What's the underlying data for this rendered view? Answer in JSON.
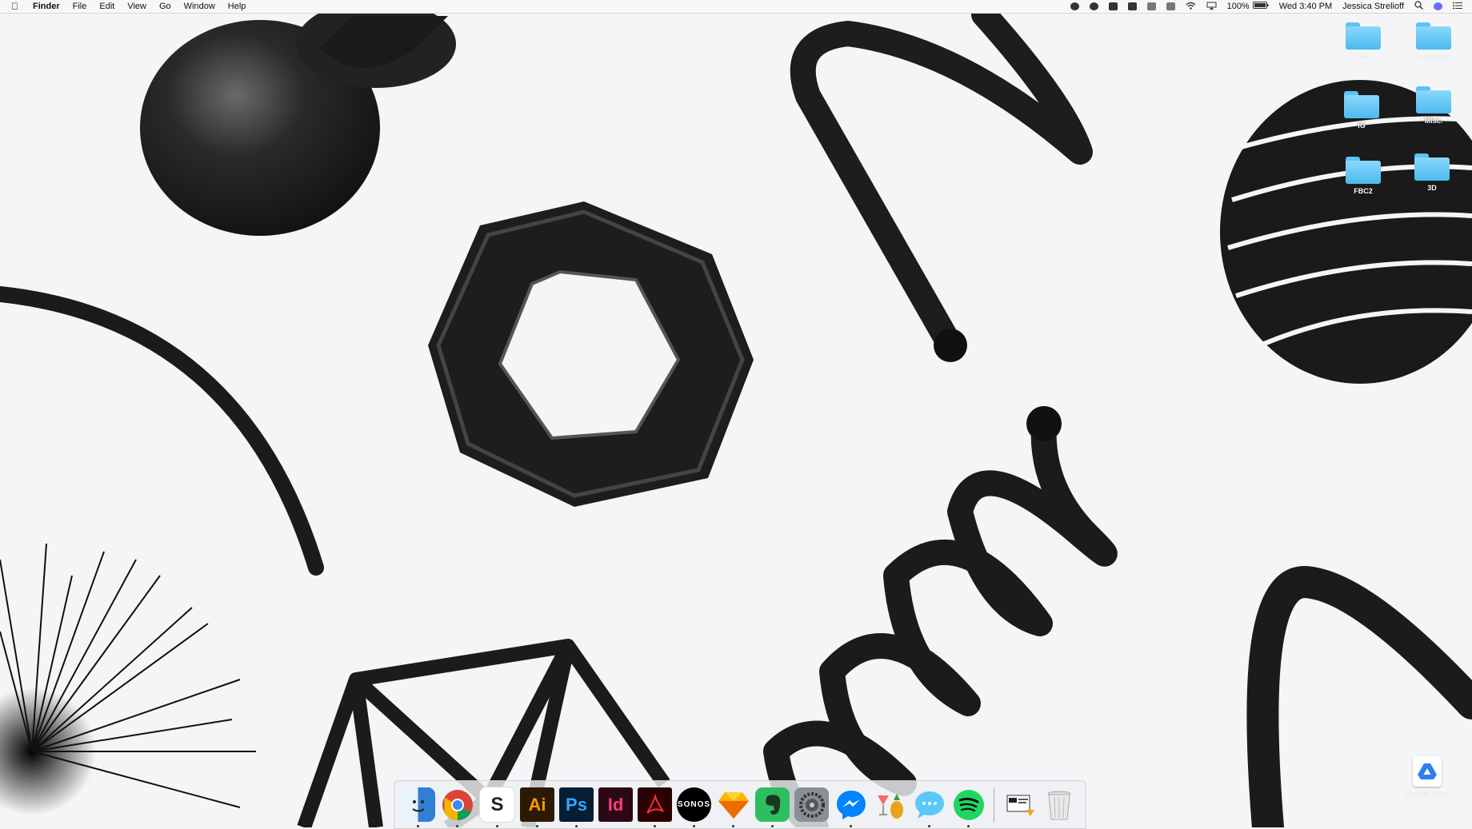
{
  "menubar": {
    "apple_icon": "apple-logo-icon",
    "app_name": "Finder",
    "menus": [
      "File",
      "Edit",
      "View",
      "Go",
      "Window",
      "Help"
    ],
    "status_icons": [
      "skype-icon",
      "creative-cloud-icon",
      "flux-icon",
      "dropbox-icon",
      "google-drive-icon",
      "bluetooth-icon",
      "wifi-icon",
      "airplay-icon"
    ],
    "battery": "100%",
    "datetime": "Wed 3:40 PM",
    "user": "Jessica Strelioff",
    "right_icons": [
      "spotlight-icon",
      "siri-icon",
      "notification-center-icon"
    ]
  },
  "desktop_icons": [
    {
      "label": "RH",
      "kind": "folder",
      "faint": true
    },
    {
      "label": "inspiration",
      "kind": "folder",
      "faint": true
    },
    {
      "label": "IG",
      "kind": "folder",
      "faint": false
    },
    {
      "label": "Misc.",
      "kind": "folder",
      "faint": false
    },
    {
      "label": "FBC2",
      "kind": "folder",
      "faint": false
    },
    {
      "label": "3D",
      "kind": "folder",
      "faint": false
    },
    {
      "label": "Google Drive",
      "kind": "app",
      "faint": true
    }
  ],
  "dock": {
    "apps": [
      {
        "name": "Finder",
        "icon": "finder-icon",
        "running": true
      },
      {
        "name": "Google Chrome",
        "icon": "chrome-icon",
        "running": true
      },
      {
        "name": "Slack",
        "icon": "slack-icon",
        "running": true,
        "glyph": "S"
      },
      {
        "name": "Adobe Illustrator",
        "icon": "illustrator-icon",
        "running": true,
        "glyph": "Ai"
      },
      {
        "name": "Adobe Photoshop",
        "icon": "photoshop-icon",
        "running": true,
        "glyph": "Ps"
      },
      {
        "name": "Adobe InDesign",
        "icon": "indesign-icon",
        "running": false,
        "glyph": "Id"
      },
      {
        "name": "Adobe Acrobat",
        "icon": "acrobat-icon",
        "running": true
      },
      {
        "name": "Sonos",
        "icon": "sonos-icon",
        "running": true,
        "glyph": "SONOS"
      },
      {
        "name": "Sketch",
        "icon": "sketch-icon",
        "running": true
      },
      {
        "name": "Evernote",
        "icon": "evernote-icon",
        "running": true
      },
      {
        "name": "System Preferences",
        "icon": "system-preferences-icon",
        "running": false
      },
      {
        "name": "Messenger",
        "icon": "messenger-icon",
        "running": true
      },
      {
        "name": "Cocktail",
        "icon": "cocktail-icon",
        "running": false
      },
      {
        "name": "Messages",
        "icon": "messages-icon",
        "running": true
      },
      {
        "name": "Spotify",
        "icon": "spotify-icon",
        "running": true
      }
    ],
    "others": [
      {
        "name": "Downloads",
        "icon": "downloads-stack-icon"
      },
      {
        "name": "Trash",
        "icon": "trash-icon"
      }
    ]
  }
}
